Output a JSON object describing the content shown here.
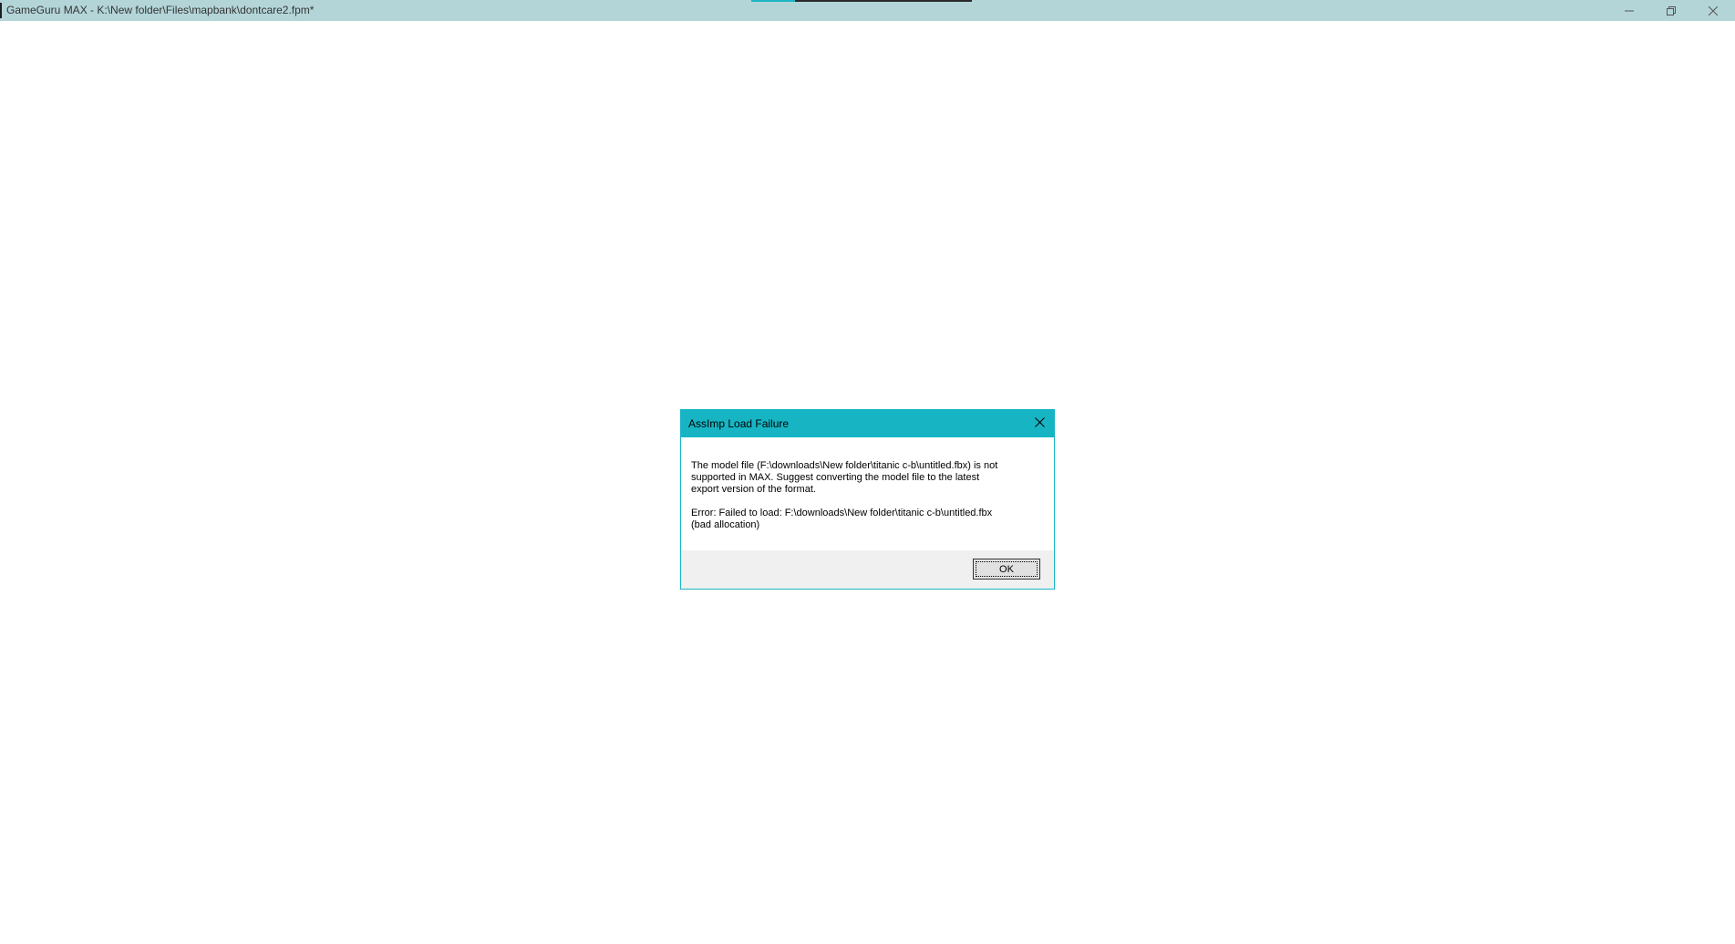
{
  "window": {
    "title": "GameGuru MAX - K:\\New folder\\Files\\mapbank\\dontcare2.fpm*",
    "background_color": "#ffffff",
    "titlebar_color": "#b3d5d8",
    "progress": 0.2,
    "progress_color": "#1ab6c3",
    "controls": {
      "minimize_icon": "minimize-icon",
      "restore_icon": "restore-icon",
      "close_icon": "close-icon"
    }
  },
  "dialog": {
    "title": "AssImp Load Failure",
    "accent_color": "#17b5c4",
    "message_1": "The model file (F:\\downloads\\New folder\\titanic c-b\\untitled.fbx) is not\nsupported in MAX. Suggest converting the model file to the latest\nexport version of the format.",
    "message_2": "Error: Failed to load: F:\\downloads\\New folder\\titanic c-b\\untitled.fbx\n(bad allocation)",
    "ok_label": "OK",
    "close_icon": "close-icon"
  }
}
